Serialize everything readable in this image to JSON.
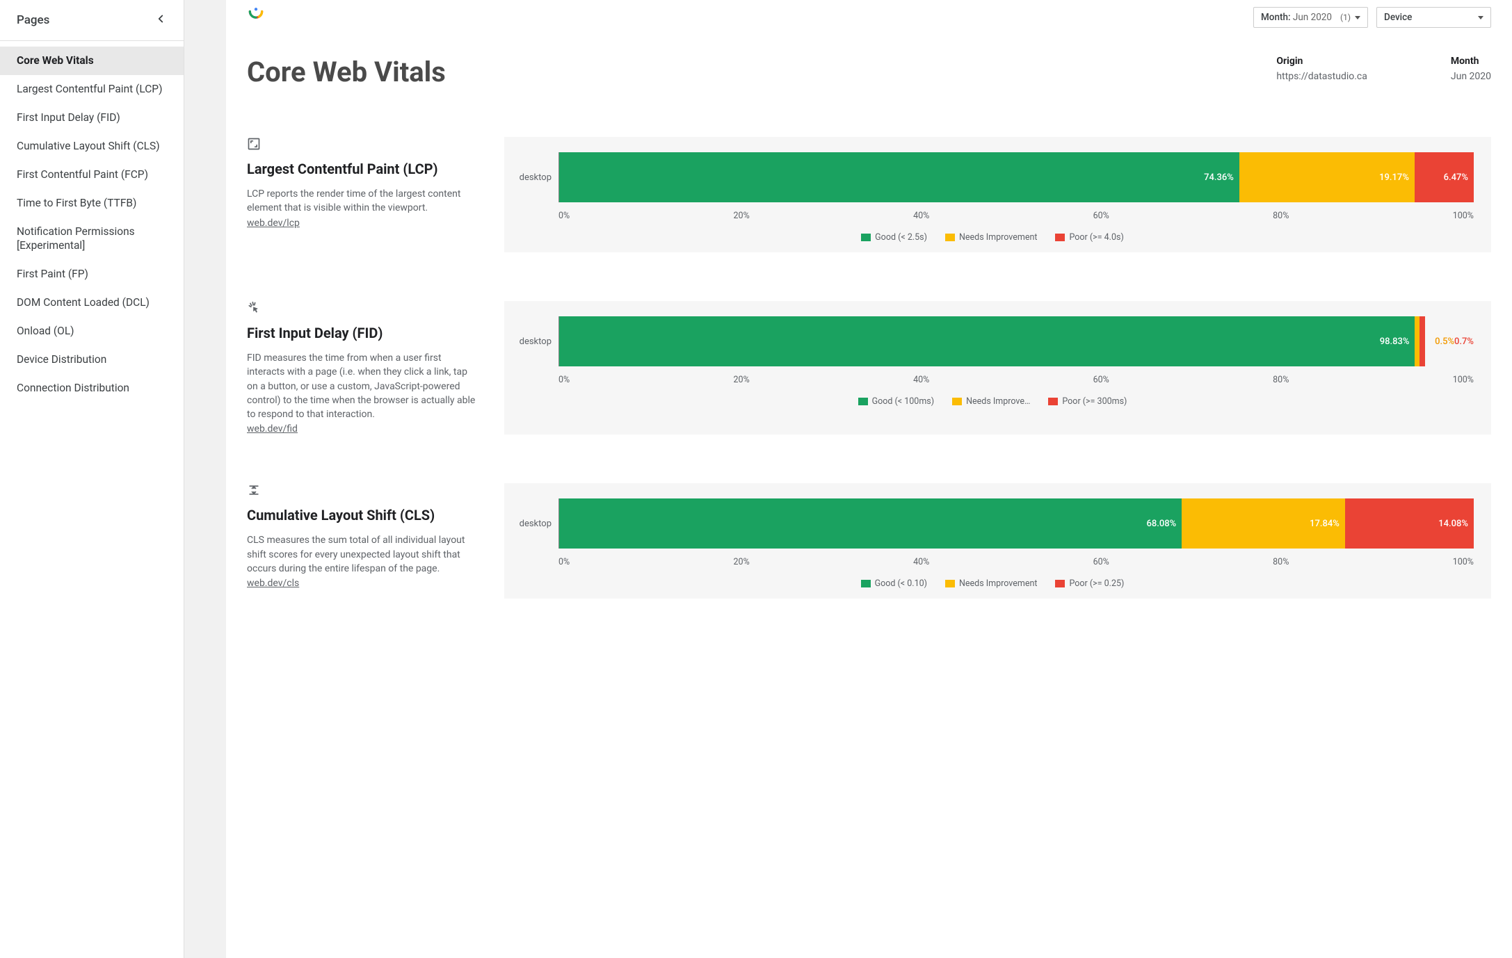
{
  "sidebar": {
    "title": "Pages",
    "items": [
      {
        "label": "Core Web Vitals",
        "active": true
      },
      {
        "label": "Largest Contentful Paint (LCP)"
      },
      {
        "label": "First Input Delay (FID)"
      },
      {
        "label": "Cumulative Layout Shift (CLS)"
      },
      {
        "label": "First Contentful Paint (FCP)"
      },
      {
        "label": "Time to First Byte (TTFB)"
      },
      {
        "label": "Notification Permissions [Experimental]"
      },
      {
        "label": "First Paint (FP)"
      },
      {
        "label": "DOM Content Loaded (DCL)"
      },
      {
        "label": "Onload (OL)"
      },
      {
        "label": "Device Distribution"
      },
      {
        "label": "Connection Distribution"
      }
    ]
  },
  "filters": {
    "month": {
      "label": "Month:",
      "value": "Jun 2020",
      "count": "(1)"
    },
    "device": {
      "label": "Device"
    }
  },
  "header": {
    "title": "Core Web Vitals",
    "origin_label": "Origin",
    "origin_value": "https://datastudio.ca",
    "month_label": "Month",
    "month_value": "Jun 2020"
  },
  "colors": {
    "good": "#1aa260",
    "ni": "#fbbc04",
    "poor": "#ea4335"
  },
  "axis": {
    "ticks": [
      "0%",
      "20%",
      "40%",
      "60%",
      "80%",
      "100%"
    ]
  },
  "metrics": [
    {
      "key": "lcp",
      "title": "Largest Contentful Paint (LCP)",
      "desc": "LCP reports the render time of the largest content element that is visible within the viewport.",
      "link_text": "web.dev/lcp",
      "device": "desktop",
      "good": 74.36,
      "ni": 19.17,
      "poor": 6.47,
      "legend": {
        "good": "Good (< 2.5s)",
        "ni": "Needs Improvement",
        "poor": "Poor (>= 4.0s)"
      }
    },
    {
      "key": "fid",
      "title": "First Input Delay (FID)",
      "desc": "FID measures the time from when a user first interacts with a page (i.e. when they click a link, tap on a button, or use a custom, JavaScript-powered control) to the time when the browser is actually able to respond to that interaction.",
      "link_text": "web.dev/fid",
      "device": "desktop",
      "good": 98.83,
      "ni": 0.5,
      "poor": 0.67,
      "legend": {
        "good": "Good (< 100ms)",
        "ni": "Needs Improve…",
        "poor": "Poor (>= 300ms)"
      }
    },
    {
      "key": "cls",
      "title": "Cumulative Layout Shift (CLS)",
      "desc": "CLS measures the sum total of all individual layout shift scores for every unexpected layout shift that occurs during the entire lifespan of the page.",
      "link_text": "web.dev/cls",
      "device": "desktop",
      "good": 68.08,
      "ni": 17.84,
      "poor": 14.08,
      "legend": {
        "good": "Good (< 0.10)",
        "ni": "Needs Improvement",
        "poor": "Poor (>= 0.25)"
      }
    }
  ],
  "chart_data": [
    {
      "type": "bar",
      "title": "Largest Contentful Paint (LCP)",
      "categories": [
        "desktop"
      ],
      "series": [
        {
          "name": "Good (< 2.5s)",
          "values": [
            74.36
          ]
        },
        {
          "name": "Needs Improvement",
          "values": [
            19.17
          ]
        },
        {
          "name": "Poor (>= 4.0s)",
          "values": [
            6.47
          ]
        }
      ],
      "xlabel": "",
      "ylabel": "",
      "xlim": [
        0,
        100
      ]
    },
    {
      "type": "bar",
      "title": "First Input Delay (FID)",
      "categories": [
        "desktop"
      ],
      "series": [
        {
          "name": "Good (< 100ms)",
          "values": [
            98.83
          ]
        },
        {
          "name": "Needs Improvement",
          "values": [
            0.5
          ]
        },
        {
          "name": "Poor (>= 300ms)",
          "values": [
            0.67
          ]
        }
      ],
      "xlabel": "",
      "ylabel": "",
      "xlim": [
        0,
        100
      ]
    },
    {
      "type": "bar",
      "title": "Cumulative Layout Shift (CLS)",
      "categories": [
        "desktop"
      ],
      "series": [
        {
          "name": "Good (< 0.10)",
          "values": [
            68.08
          ]
        },
        {
          "name": "Needs Improvement",
          "values": [
            17.84
          ]
        },
        {
          "name": "Poor (>= 0.25)",
          "values": [
            14.08
          ]
        }
      ],
      "xlabel": "",
      "ylabel": "",
      "xlim": [
        0,
        100
      ]
    }
  ]
}
